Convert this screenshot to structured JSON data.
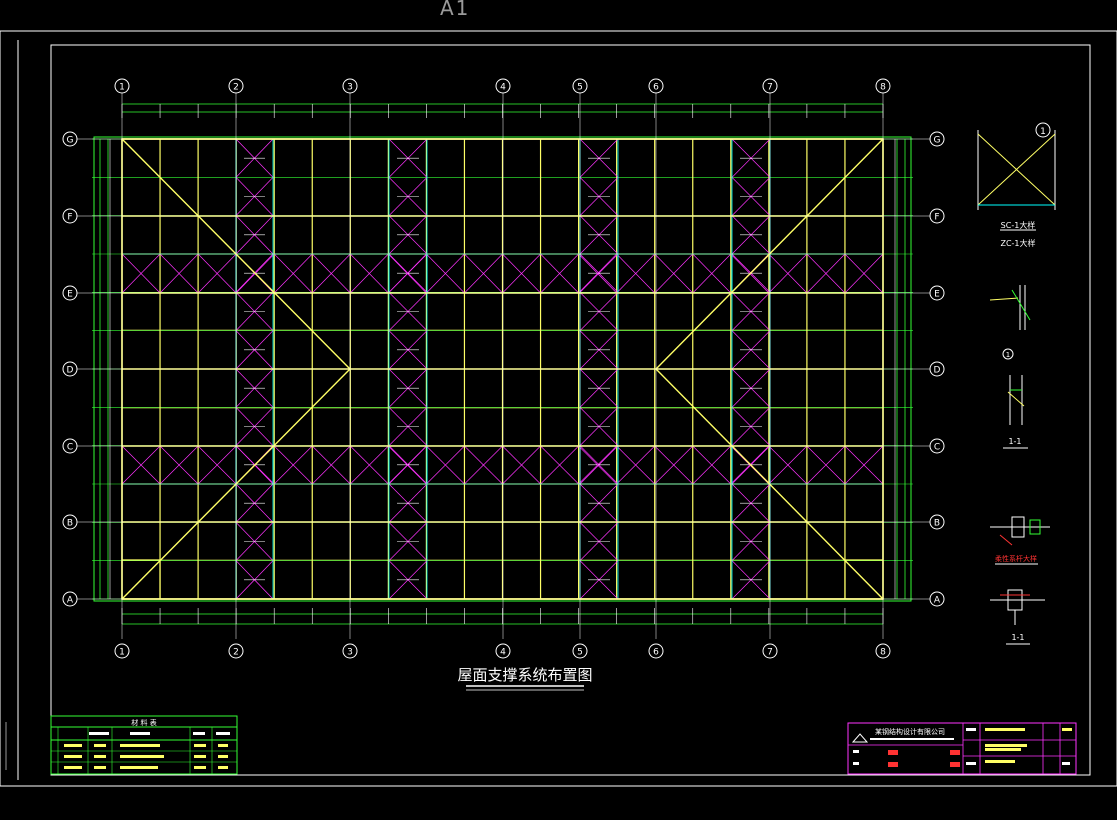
{
  "sheet": {
    "label": "A1"
  },
  "drawing": {
    "title": "屋面支撑系统布置图",
    "column_axis_labels": [
      "1",
      "2",
      "3",
      "4",
      "5",
      "6",
      "7",
      "8"
    ],
    "row_axis_labels": [
      "G",
      "F",
      "E",
      "D",
      "C",
      "B",
      "A"
    ]
  },
  "details": {
    "sc_title_top": "SC-1大样",
    "sc_title_bottom": "ZC-1大样",
    "node_mark": "1",
    "section_label_1": "1-1",
    "detail_caption_3": "柔性系杆大样",
    "section_label_2": "1-1"
  },
  "material_table": {
    "title": "材 料 表"
  },
  "title_block": {
    "company": "某钢结构设计有限公司"
  },
  "colors": {
    "background": "#000000",
    "frame": "#ffffff",
    "yellow": "#ffff66",
    "cyan": "#00ffff",
    "magenta": "#ff33ff",
    "green": "#33ff33",
    "white": "#ffffff",
    "red": "#ff3333"
  }
}
